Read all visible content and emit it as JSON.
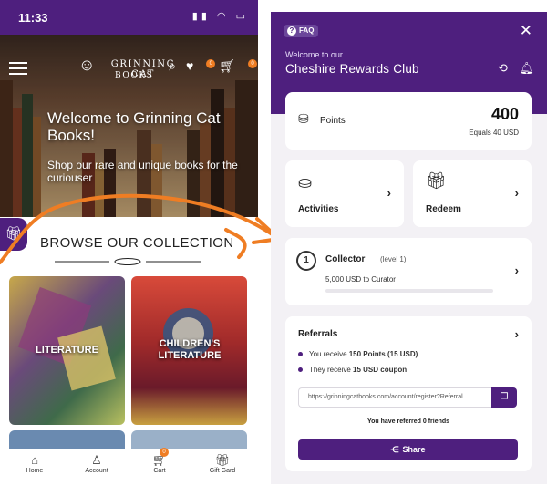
{
  "left_app": {
    "status": {
      "time": "11:33"
    },
    "logo": {
      "line1": "GRINNING CAT",
      "line2": "BOOKS"
    },
    "hero": {
      "title": "Welcome to Grinning Cat Books!",
      "subtitle": "Shop our rare and unique books for the curiouser"
    },
    "cart_badge": "0",
    "wishlist_badge": "0",
    "browse_title": "BROWSE OUR COLLECTION",
    "collections": [
      {
        "label": "LITERATURE"
      },
      {
        "label": "CHILDREN'S LITERATURE"
      }
    ],
    "bottom_nav": [
      {
        "label": "Home",
        "icon": "home-icon"
      },
      {
        "label": "Account",
        "icon": "user-icon"
      },
      {
        "label": "Cart",
        "icon": "cart-icon",
        "badge": "0"
      },
      {
        "label": "Gift Gard",
        "icon": "gift-card-icon"
      }
    ]
  },
  "right_app": {
    "faq_label": "FAQ",
    "welcome_text": "Welcome to our",
    "club_name": "Cheshire Rewards Club",
    "points": {
      "label": "Points",
      "value": "400",
      "equals": "Equals 40 USD"
    },
    "activities_label": "Activities",
    "redeem_label": "Redeem",
    "tier": {
      "name": "Collector",
      "level": "(level 1)",
      "next": "5,000 USD to Curator",
      "progress": 0
    },
    "referrals": {
      "title": "Referrals",
      "you_prefix": "You receive ",
      "you_reward": "150 Points (15 USD)",
      "they_prefix": "They receive ",
      "they_reward": "15 USD coupon",
      "link": "https://grinningcatbooks.com/account/register?Referral...",
      "count_text": "You have referred 0 friends",
      "share_label": "Share"
    }
  },
  "colors": {
    "brand_purple": "#4e1f7e",
    "accent_orange": "#ef7d23"
  }
}
